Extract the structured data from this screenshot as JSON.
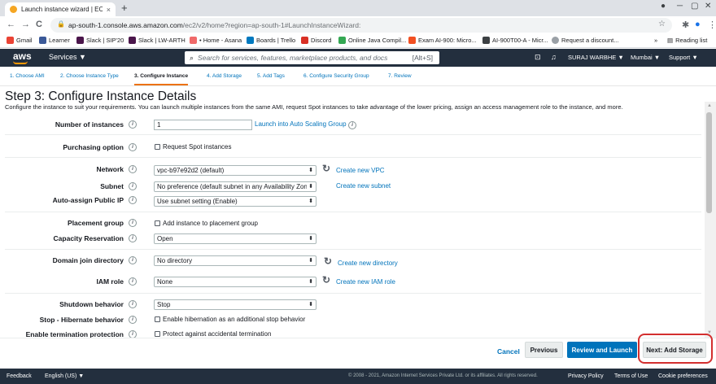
{
  "browser": {
    "tab_title": "Launch instance wizard | EC2 Ma",
    "tab_close": "×",
    "new_tab": "+",
    "window_controls": [
      "─",
      "▢",
      "✕"
    ],
    "url_host": "ap-south-1.console.aws.amazon.com",
    "url_path": "/ec2/v2/home?region=ap-south-1#LaunchInstanceWizard:",
    "nav": [
      "←",
      "→",
      "C"
    ],
    "bookmarks": [
      {
        "label": "Gmail",
        "color": "#ea4335"
      },
      {
        "label": "Learner",
        "color": "#3b5998"
      },
      {
        "label": "Slack | SIP'20",
        "color": "#4a154b"
      },
      {
        "label": "Slack | LW-ARTH",
        "color": "#4a154b"
      },
      {
        "label": "• Home - Asana",
        "color": "#f06a6a"
      },
      {
        "label": "Boards | Trello",
        "color": "#0079bf"
      },
      {
        "label": "Discord",
        "color": "#d93025"
      },
      {
        "label": "Online Java Compil...",
        "color": "#34a853"
      },
      {
        "label": "Exam AI-900: Micro...",
        "color": "#f25022"
      },
      {
        "label": "AI-900T00-A - Micr...",
        "color": "#3c4043"
      },
      {
        "label": "Request a discount...",
        "color": "#9aa0a6"
      }
    ],
    "bookmarks_more": "»",
    "reading_list": "Reading list"
  },
  "awsnav": {
    "logo": "aws",
    "services": "Services ▼",
    "search_placeholder": "Search for services, features, marketplace products, and docs",
    "search_shortcut": "[Alt+S]",
    "user": "SURAJ WARBHE ▼",
    "region": "Mumbai ▼",
    "support": "Support ▼"
  },
  "steps": [
    {
      "label": "1. Choose AMI"
    },
    {
      "label": "2. Choose Instance Type"
    },
    {
      "label": "3. Configure Instance",
      "active": true
    },
    {
      "label": "4. Add Storage"
    },
    {
      "label": "5. Add Tags"
    },
    {
      "label": "6. Configure Security Group"
    },
    {
      "label": "7. Review"
    }
  ],
  "page": {
    "title": "Step 3: Configure Instance Details",
    "description": "Configure the instance to suit your requirements. You can launch multiple instances from the same AMI, request Spot instances to take advantage of the lower pricing, assign an access management role to the instance, and more."
  },
  "form": {
    "number_of_instances": {
      "label": "Number of instances",
      "value": "1",
      "link": "Launch into Auto Scaling Group"
    },
    "purchasing_option": {
      "label": "Purchasing option",
      "checkbox": "Request Spot instances"
    },
    "network": {
      "label": "Network",
      "value": "vpc-b97e92d2 (default)",
      "link": "Create new VPC"
    },
    "subnet": {
      "label": "Subnet",
      "value": "No preference (default subnet in any Availability Zone",
      "link": "Create new subnet"
    },
    "public_ip": {
      "label": "Auto-assign Public IP",
      "value": "Use subnet setting (Enable)"
    },
    "placement_group": {
      "label": "Placement group",
      "checkbox": "Add instance to placement group"
    },
    "capacity_reservation": {
      "label": "Capacity Reservation",
      "value": "Open"
    },
    "domain_join": {
      "label": "Domain join directory",
      "value": "No directory",
      "link": "Create new directory"
    },
    "iam_role": {
      "label": "IAM role",
      "value": "None",
      "link": "Create new IAM role"
    },
    "shutdown_behavior": {
      "label": "Shutdown behavior",
      "value": "Stop"
    },
    "stop_hibernate": {
      "label": "Stop - Hibernate behavior",
      "checkbox": "Enable hibernation as an additional stop behavior"
    },
    "termination_protection": {
      "label": "Enable termination protection",
      "checkbox": "Protect against accidental termination"
    }
  },
  "actions": {
    "cancel": "Cancel",
    "previous": "Previous",
    "review_launch": "Review and Launch",
    "next": "Next: Add Storage"
  },
  "footer": {
    "feedback": "Feedback",
    "language": "English (US) ▼",
    "copyright": "© 2008 - 2021, Amazon Internet Services Private Ltd. or its affiliates. All rights reserved.",
    "privacy": "Privacy Policy",
    "terms": "Terms of Use",
    "cookies": "Cookie preferences"
  },
  "colors": {
    "aws_nav": "#232f3e",
    "accent": "#ec7211",
    "link": "#0073bb",
    "primary_button": "#0073bb",
    "highlight": "#d32f2f"
  }
}
